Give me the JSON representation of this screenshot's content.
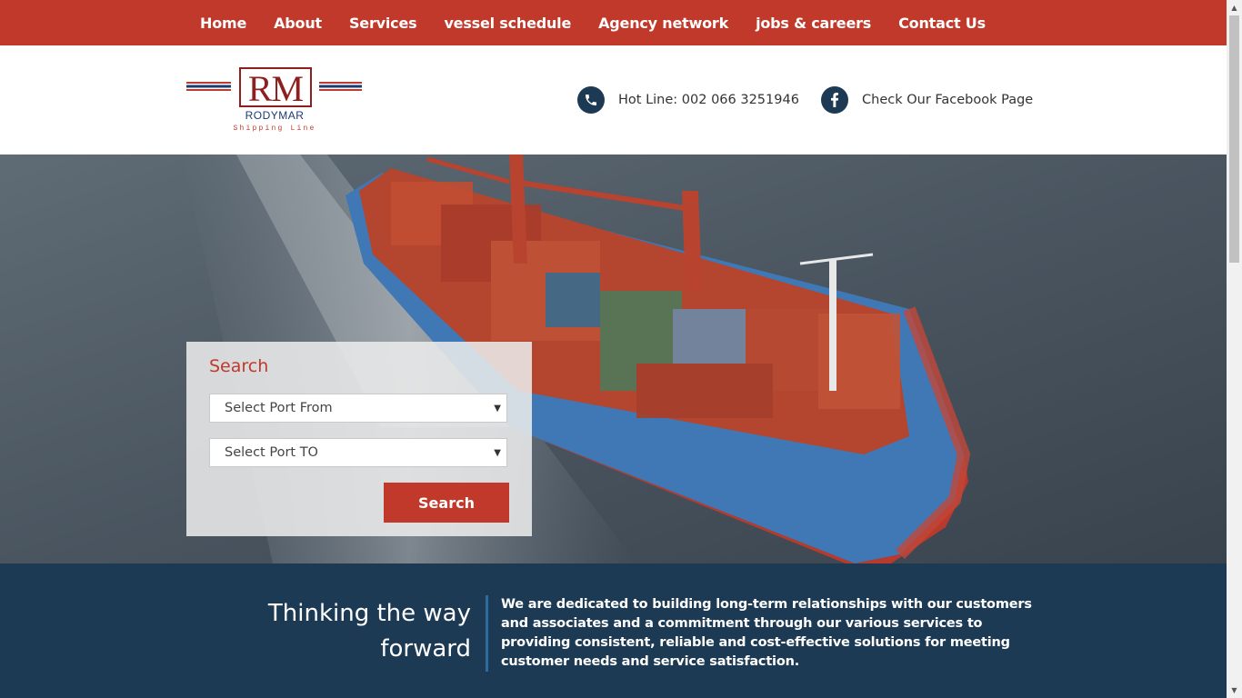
{
  "nav": {
    "items": [
      "Home",
      "About",
      "Services",
      "vessel schedule",
      "Agency network",
      "jobs & careers",
      "Contact Us"
    ]
  },
  "header": {
    "logo": {
      "monogram": "RM",
      "name": "RODYMAR",
      "tagline": "Shipping Line"
    },
    "hotline": "Hot Line: 002 066 3251946",
    "facebook": "Check Our Facebook Page",
    "icons": {
      "phone": "phone-icon",
      "facebook": "facebook-icon"
    }
  },
  "search": {
    "title": "Search",
    "port_from": "Select Port From",
    "port_to": "Select Port TO",
    "button": "Search"
  },
  "about": {
    "tagline": "Thinking the way forward",
    "text": "We are dedicated to building long-term relationships with our customers and associates and a commitment through our various services to providing consistent, reliable and cost-effective solutions for meeting customer needs and service satisfaction."
  },
  "colors": {
    "brand_red": "#c0392b",
    "navy": "#1c3a53",
    "accent_blue": "#2e6aa0"
  }
}
